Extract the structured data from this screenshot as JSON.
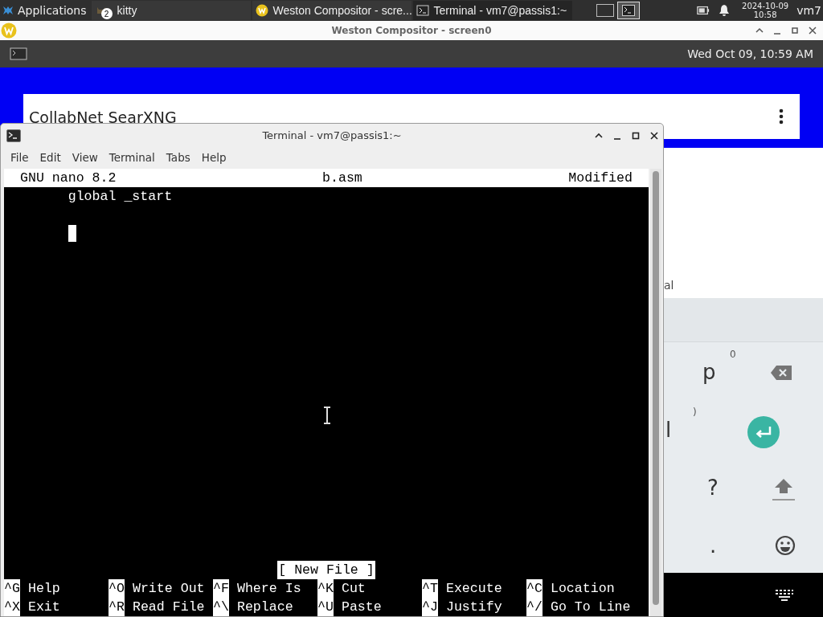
{
  "taskbar": {
    "apps_menu": {
      "label": "Applications"
    },
    "tasks": [
      {
        "kind": "kitty",
        "label": "kitty",
        "badge": "2",
        "selected": false
      },
      {
        "kind": "weston",
        "label": "Weston Compositor - scre...",
        "selected": false
      },
      {
        "kind": "terminal",
        "label": "Terminal - vm7@passis1:~",
        "selected": true
      }
    ],
    "workspaces": [
      {
        "selected": false
      },
      {
        "selected": true
      }
    ],
    "clock": {
      "date": "2024-10-09",
      "time": "10:58"
    },
    "user": "vm7"
  },
  "weston": {
    "title": "Weston Compositor - screen0",
    "panel_clock": "Wed Oct 09, 10:59 AM"
  },
  "android": {
    "app_title": "CollabNet SearXNG",
    "partial_text": "al",
    "keys": [
      {
        "kind": "hint",
        "label": "0"
      },
      {
        "kind": "char",
        "label": "p"
      },
      {
        "kind": "backspace"
      },
      {
        "kind": "hint",
        "label": ")"
      },
      {
        "kind": "char",
        "label": "l"
      },
      {
        "kind": "enter"
      },
      {
        "kind": "char",
        "label": "?"
      },
      {
        "kind": "shift"
      },
      {
        "kind": "char",
        "label": "."
      },
      {
        "kind": "emoji"
      }
    ]
  },
  "terminal": {
    "title": "Terminal - vm7@passis1:~",
    "menu": [
      "File",
      "Edit",
      "View",
      "Terminal",
      "Tabs",
      "Help"
    ],
    "nano": {
      "version": "GNU nano 8.2",
      "filename": "b.asm",
      "state": "Modified",
      "lines": [
        {
          "text": "\tglobal _start",
          "cursor": false
        },
        {
          "cursor": false
        },
        {
          "cursor": true
        }
      ],
      "status": "[ New File ]",
      "shortcuts": [
        [
          {
            "key": "^G",
            "label": "Help"
          },
          {
            "key": "^O",
            "label": "Write Out"
          },
          {
            "key": "^F",
            "label": "Where Is"
          },
          {
            "key": "^K",
            "label": "Cut"
          },
          {
            "key": "^T",
            "label": "Execute"
          },
          {
            "key": "^C",
            "label": "Location"
          }
        ],
        [
          {
            "key": "^X",
            "label": "Exit"
          },
          {
            "key": "^R",
            "label": "Read File"
          },
          {
            "key": "^\\",
            "label": "Replace"
          },
          {
            "key": "^U",
            "label": "Paste"
          },
          {
            "key": "^J",
            "label": "Justify"
          },
          {
            "key": "^/",
            "label": "Go To Line"
          }
        ]
      ]
    }
  }
}
